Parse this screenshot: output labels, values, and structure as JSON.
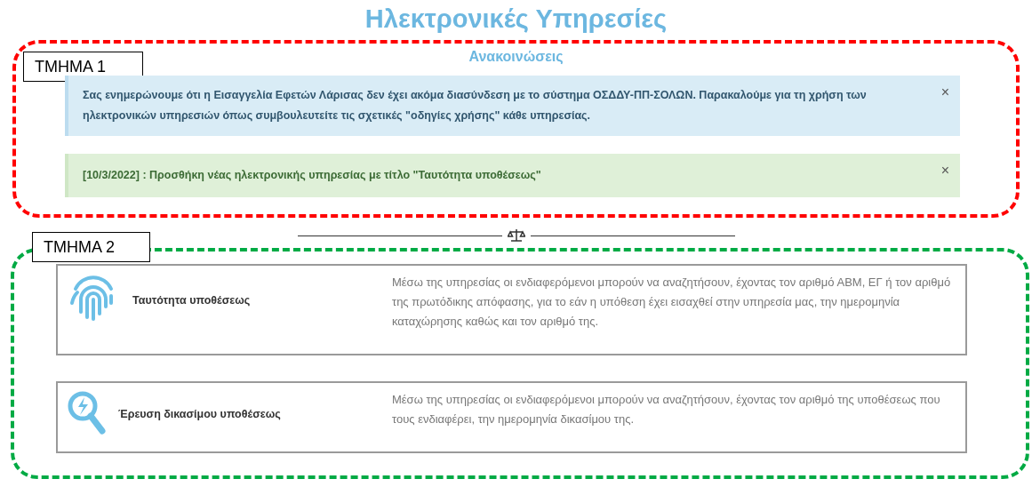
{
  "title": "Ηλεκτρονικές Υπηρεσίες",
  "section_1": {
    "label": "ΤΜΗΜΑ 1",
    "heading": "Ανακοινώσεις",
    "alerts": [
      {
        "kind": "info",
        "text": "Σας ενημερώνουμε ότι η Εισαγγελία Εφετών Λάρισας δεν έχει ακόμα διασύνδεση με το σύστημα ΟΣΔΔΥ-ΠΠ-ΣΟΛΩΝ. Παρακαλούμε για τη χρήση των ηλεκτρονικών υπηρεσιών όπως συμβουλευτείτε τις σχετικές \"οδηγίες χρήσης\" κάθε υπηρεσίας.",
        "close": "×"
      },
      {
        "kind": "success",
        "text": "[10/3/2022] : Προσθήκη νέας ηλεκτρονικής υπηρεσίας με τίτλο \"Ταυτότητα υποθέσεως\"",
        "close": "×"
      }
    ]
  },
  "section_2": {
    "label": "ΤΜΗΜΑ 2",
    "services": [
      {
        "kind": "fingerprint",
        "name": "Ταυτότητα υποθέσεως",
        "description": "Μέσω της υπηρεσίας οι ενδιαφερόμενοι μπορούν να αναζητήσουν, έχοντας τον αριθμό ΑΒΜ, ΕΓ  ή τον αριθμό της πρωτόδικης απόφασης, για το εάν η υπόθεση έχει εισαχθεί στην υπηρεσία μας, την ημερομηνία καταχώρησης καθώς και τον αριθμό της."
      },
      {
        "kind": "search",
        "name": "Έρευση δικασίμου υποθέσεως",
        "description": "Μέσω της υπηρεσίας οι ενδιαφερόμενοι μπορούν να αναζητήσουν, έχοντας τον αριθμό της υποθέσεως που τους ενδιαφέρει, την ημερομηνία δικασίμου της."
      }
    ]
  }
}
